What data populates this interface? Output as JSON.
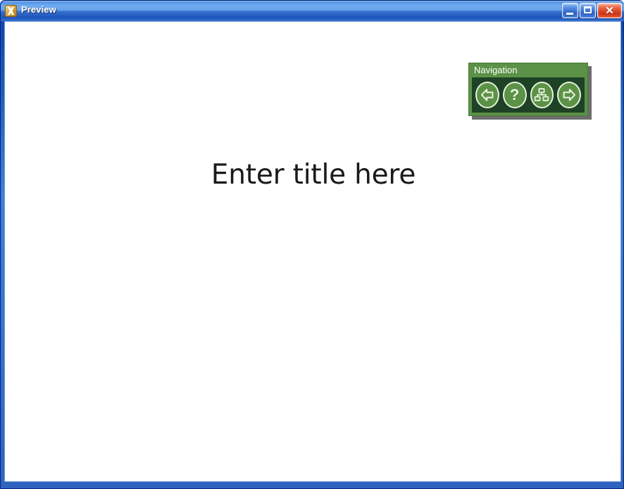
{
  "window": {
    "title": "Preview",
    "app_icon": "app-x-icon",
    "controls": {
      "minimize_label": "Minimize",
      "maximize_label": "Maximize",
      "close_label": "Close",
      "close_glyph": "✕"
    },
    "titlebar_color": "#3871cf",
    "frame_color": "#2e63bf"
  },
  "slide": {
    "title_placeholder": "Enter title here",
    "background_color": "#ffffff",
    "title_color": "#1a1a1a"
  },
  "navigation": {
    "header": "Navigation",
    "header_color": "#5c9247",
    "body_color": "#1e4226",
    "icon_color": "#e8f2de",
    "buttons": [
      {
        "name": "previous",
        "icon": "arrow-left-icon",
        "label": "Previous"
      },
      {
        "name": "help",
        "icon": "question-mark-icon",
        "label": "Help",
        "glyph": "?"
      },
      {
        "name": "sitemap",
        "icon": "sitemap-icon",
        "label": "Site Map"
      },
      {
        "name": "next",
        "icon": "arrow-right-icon",
        "label": "Next"
      }
    ]
  }
}
